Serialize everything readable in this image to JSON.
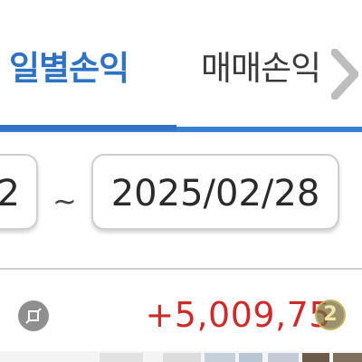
{
  "tabs": {
    "active_label": "일별손익",
    "inactive_label": "매매손익"
  },
  "date_range": {
    "start_visible": "2",
    "separator": "~",
    "end": "2025/02/28"
  },
  "summary": {
    "profit": "+5,009,75",
    "badge": "2"
  },
  "colors": {
    "accent": "#2f72c4",
    "profit": "#cc2b2b"
  }
}
